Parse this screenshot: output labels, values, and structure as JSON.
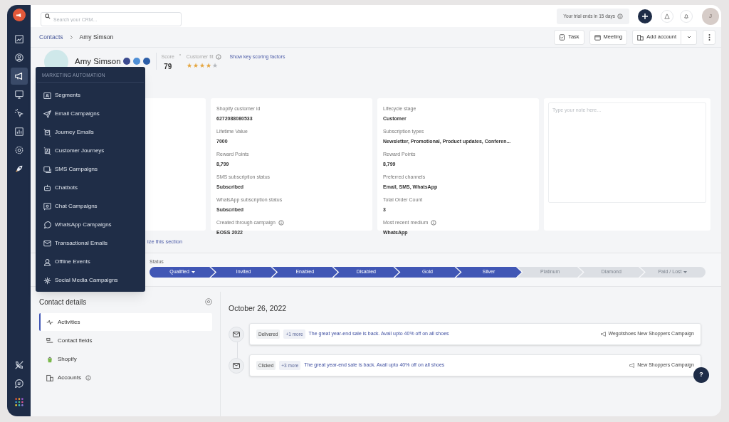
{
  "search": {
    "placeholder": "Search your CRM..."
  },
  "trial_banner": "Your trial ends in 15 days",
  "user_avatar": "J",
  "sidebar": {
    "items": [
      {
        "selected": false
      },
      {
        "selected": false
      },
      {
        "selected": true
      },
      {
        "selected": false
      },
      {
        "selected": false
      },
      {
        "selected": false
      },
      {
        "selected": false
      },
      {
        "selected": false
      }
    ],
    "bottom_items": [
      {
        "selected": false
      },
      {
        "selected": false
      },
      {
        "selected": false
      }
    ]
  },
  "breadcrumb": [
    "Contacts",
    "Amy Simson"
  ],
  "actions": [
    "Task",
    "Meeting",
    "Add account"
  ],
  "contact": {
    "name": "Amy Simson",
    "score_label": "Score",
    "score": "79",
    "fit_label": "Customer fit",
    "stars": 4,
    "scoring_link": "Show key scoring factors"
  },
  "menu": {
    "title": "MARKETING AUTOMATION",
    "items": [
      "Segments",
      "Email Campaigns",
      "Journey Emails",
      "Customer Journeys",
      "SMS Campaigns",
      "Chatbots",
      "Chat Campaigns",
      "WhatsApp Campaigns",
      "Transactional Emails",
      "Offline Events",
      "Social Media Campaigns"
    ]
  },
  "cards": [
    {
      "fields": [
        {
          "label": "Shopify customer id",
          "value": "6272088080533",
          "info": false
        },
        {
          "label": "Lifetime Value",
          "value": "7000",
          "info": false
        },
        {
          "label": "Reward Points",
          "value": "8,799",
          "info": false
        },
        {
          "label": "SMS subscription status",
          "value": "Subscribed",
          "info": false
        },
        {
          "label": "WhatsApp subscription status",
          "value": "Subscribed",
          "info": false
        },
        {
          "label": "Created through campaign",
          "value": "EOSS 2022",
          "info": true
        }
      ]
    },
    {
      "fields": [
        {
          "label": "Lifecycle stage",
          "value": "Customer",
          "info": false
        },
        {
          "label": "Subscription types",
          "value": "Newsletter, Promotional, Product updates, Conferen...",
          "info": false
        },
        {
          "label": "Reward Points",
          "value": "8,799",
          "info": false
        },
        {
          "label": "Preferred channels",
          "value": "Email, SMS, WhatsApp",
          "info": false
        },
        {
          "label": "Total Order Count",
          "value": "3",
          "info": false
        },
        {
          "label": "Most recent medium",
          "value": "WhatsApp",
          "info": true
        }
      ]
    }
  ],
  "note": {
    "placeholder": "Type your note here..."
  },
  "customize_link": "ize this section",
  "status": {
    "label": "Status",
    "stages": [
      {
        "label": "Qualified",
        "done": true,
        "dropdown": true
      },
      {
        "label": "Invited",
        "done": true,
        "dropdown": false
      },
      {
        "label": "Enabled",
        "done": true,
        "dropdown": false
      },
      {
        "label": "Disabled",
        "done": true,
        "dropdown": false
      },
      {
        "label": "Gold",
        "done": true,
        "dropdown": false
      },
      {
        "label": "Silver",
        "done": true,
        "dropdown": false
      },
      {
        "label": "Platinum",
        "done": false,
        "dropdown": false
      },
      {
        "label": "Diamond",
        "done": false,
        "dropdown": false
      },
      {
        "label": "Paid / Lost",
        "done": false,
        "dropdown": true
      }
    ]
  },
  "contact_details": {
    "title": "Contact details",
    "items": [
      {
        "label": "Activities",
        "selected": true,
        "info": false
      },
      {
        "label": "Contact fields",
        "selected": false,
        "info": false
      },
      {
        "label": "Shopify",
        "selected": false,
        "info": false
      },
      {
        "label": "Accounts",
        "selected": false,
        "info": true
      }
    ]
  },
  "timeline": {
    "date": "October 26, 2022",
    "events": [
      {
        "status": "Delivered",
        "more": "+1 more",
        "text": "The great year-end sale is back. Avail upto 40% off on all shoes",
        "campaign": "Wegotshoes New Shoppers Campaign"
      },
      {
        "status": "Clicked",
        "more": "+3 more",
        "text": "The great year-end sale is back. Avail upto 40% off on all shoes",
        "campaign": "New Shoppers Campaign"
      }
    ]
  },
  "help": "?"
}
